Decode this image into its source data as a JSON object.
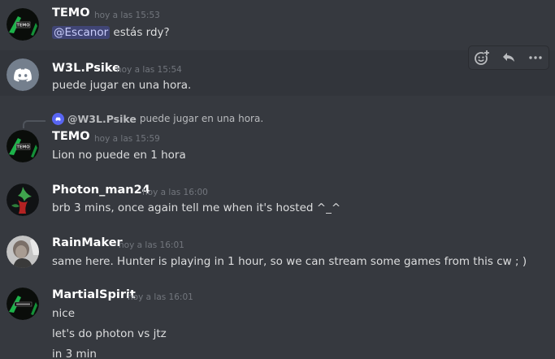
{
  "messages": [
    {
      "username": "TEMO",
      "timestamp": "hoy a las 15:53",
      "mention": "@Escanor",
      "text": "estás rdy?"
    },
    {
      "username": "W3L.Psike",
      "timestamp": "hoy a las 15:54",
      "text": "puede jugar en una hora."
    },
    {
      "reply": {
        "username": "@W3L.Psike",
        "text": "puede jugar en una hora."
      },
      "username": "TEMO",
      "timestamp": "hoy a las 15:59",
      "text": "Lion no puede en 1 hora"
    },
    {
      "username": "Photon_man24",
      "timestamp": "hoy a las 16:00",
      "text": "brb 3 mins, once again tell me when it's hosted ^_^"
    },
    {
      "username": "RainMaker",
      "timestamp": "hoy a las 16:01",
      "text": "same here. Hunter is playing in 1 hour, so we can stream some games from this cw ; )"
    },
    {
      "username": "MartialSpirit",
      "timestamp": "hoy a las 16:01",
      "lines": [
        "nice",
        "let's do photon vs jtz",
        "in 3 min"
      ]
    }
  ],
  "toolbar": {
    "icons": [
      "add-reaction-icon",
      "reply-icon",
      "more-icon"
    ]
  },
  "colors": {
    "background": "#36393f",
    "hover": "#32353b",
    "username": "#ffffff",
    "text": "#dcddde",
    "timestamp": "#72767d",
    "mention": "#c9cdfb",
    "blurple": "#5865f2"
  }
}
